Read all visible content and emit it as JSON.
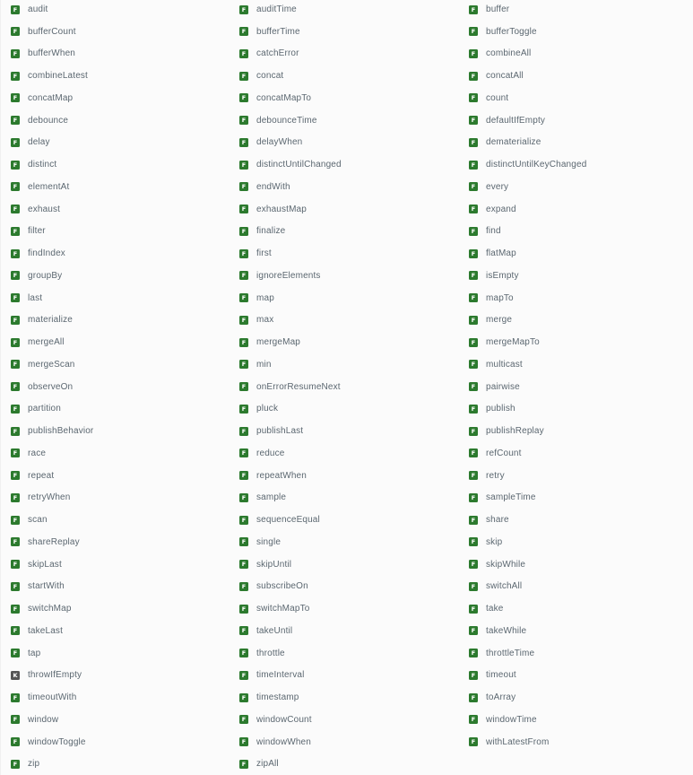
{
  "columns": [
    [
      {
        "badge": "F",
        "name": "audit"
      },
      {
        "badge": "F",
        "name": "bufferCount"
      },
      {
        "badge": "F",
        "name": "bufferWhen"
      },
      {
        "badge": "F",
        "name": "combineLatest"
      },
      {
        "badge": "F",
        "name": "concatMap"
      },
      {
        "badge": "F",
        "name": "debounce"
      },
      {
        "badge": "F",
        "name": "delay"
      },
      {
        "badge": "F",
        "name": "distinct"
      },
      {
        "badge": "F",
        "name": "elementAt"
      },
      {
        "badge": "F",
        "name": "exhaust"
      },
      {
        "badge": "F",
        "name": "filter"
      },
      {
        "badge": "F",
        "name": "findIndex"
      },
      {
        "badge": "F",
        "name": "groupBy"
      },
      {
        "badge": "F",
        "name": "last"
      },
      {
        "badge": "F",
        "name": "materialize"
      },
      {
        "badge": "F",
        "name": "mergeAll"
      },
      {
        "badge": "F",
        "name": "mergeScan"
      },
      {
        "badge": "F",
        "name": "observeOn"
      },
      {
        "badge": "F",
        "name": "partition"
      },
      {
        "badge": "F",
        "name": "publishBehavior"
      },
      {
        "badge": "F",
        "name": "race"
      },
      {
        "badge": "F",
        "name": "repeat"
      },
      {
        "badge": "F",
        "name": "retryWhen"
      },
      {
        "badge": "F",
        "name": "scan"
      },
      {
        "badge": "F",
        "name": "shareReplay"
      },
      {
        "badge": "F",
        "name": "skipLast"
      },
      {
        "badge": "F",
        "name": "startWith"
      },
      {
        "badge": "F",
        "name": "switchMap"
      },
      {
        "badge": "F",
        "name": "takeLast"
      },
      {
        "badge": "F",
        "name": "tap"
      },
      {
        "badge": "K",
        "name": "throwIfEmpty"
      },
      {
        "badge": "F",
        "name": "timeoutWith"
      },
      {
        "badge": "F",
        "name": "window"
      },
      {
        "badge": "F",
        "name": "windowToggle"
      },
      {
        "badge": "F",
        "name": "zip"
      }
    ],
    [
      {
        "badge": "F",
        "name": "auditTime"
      },
      {
        "badge": "F",
        "name": "bufferTime"
      },
      {
        "badge": "F",
        "name": "catchError"
      },
      {
        "badge": "F",
        "name": "concat"
      },
      {
        "badge": "F",
        "name": "concatMapTo"
      },
      {
        "badge": "F",
        "name": "debounceTime"
      },
      {
        "badge": "F",
        "name": "delayWhen"
      },
      {
        "badge": "F",
        "name": "distinctUntilChanged"
      },
      {
        "badge": "F",
        "name": "endWith"
      },
      {
        "badge": "F",
        "name": "exhaustMap"
      },
      {
        "badge": "F",
        "name": "finalize"
      },
      {
        "badge": "F",
        "name": "first"
      },
      {
        "badge": "F",
        "name": "ignoreElements"
      },
      {
        "badge": "F",
        "name": "map"
      },
      {
        "badge": "F",
        "name": "max"
      },
      {
        "badge": "F",
        "name": "mergeMap"
      },
      {
        "badge": "F",
        "name": "min"
      },
      {
        "badge": "F",
        "name": "onErrorResumeNext"
      },
      {
        "badge": "F",
        "name": "pluck"
      },
      {
        "badge": "F",
        "name": "publishLast"
      },
      {
        "badge": "F",
        "name": "reduce"
      },
      {
        "badge": "F",
        "name": "repeatWhen"
      },
      {
        "badge": "F",
        "name": "sample"
      },
      {
        "badge": "F",
        "name": "sequenceEqual"
      },
      {
        "badge": "F",
        "name": "single"
      },
      {
        "badge": "F",
        "name": "skipUntil"
      },
      {
        "badge": "F",
        "name": "subscribeOn"
      },
      {
        "badge": "F",
        "name": "switchMapTo"
      },
      {
        "badge": "F",
        "name": "takeUntil"
      },
      {
        "badge": "F",
        "name": "throttle"
      },
      {
        "badge": "F",
        "name": "timeInterval"
      },
      {
        "badge": "F",
        "name": "timestamp"
      },
      {
        "badge": "F",
        "name": "windowCount"
      },
      {
        "badge": "F",
        "name": "windowWhen"
      },
      {
        "badge": "F",
        "name": "zipAll"
      }
    ],
    [
      {
        "badge": "F",
        "name": "buffer"
      },
      {
        "badge": "F",
        "name": "bufferToggle"
      },
      {
        "badge": "F",
        "name": "combineAll"
      },
      {
        "badge": "F",
        "name": "concatAll"
      },
      {
        "badge": "F",
        "name": "count"
      },
      {
        "badge": "F",
        "name": "defaultIfEmpty"
      },
      {
        "badge": "F",
        "name": "dematerialize"
      },
      {
        "badge": "F",
        "name": "distinctUntilKeyChanged"
      },
      {
        "badge": "F",
        "name": "every"
      },
      {
        "badge": "F",
        "name": "expand"
      },
      {
        "badge": "F",
        "name": "find"
      },
      {
        "badge": "F",
        "name": "flatMap"
      },
      {
        "badge": "F",
        "name": "isEmpty"
      },
      {
        "badge": "F",
        "name": "mapTo"
      },
      {
        "badge": "F",
        "name": "merge"
      },
      {
        "badge": "F",
        "name": "mergeMapTo"
      },
      {
        "badge": "F",
        "name": "multicast"
      },
      {
        "badge": "F",
        "name": "pairwise"
      },
      {
        "badge": "F",
        "name": "publish"
      },
      {
        "badge": "F",
        "name": "publishReplay"
      },
      {
        "badge": "F",
        "name": "refCount"
      },
      {
        "badge": "F",
        "name": "retry"
      },
      {
        "badge": "F",
        "name": "sampleTime"
      },
      {
        "badge": "F",
        "name": "share"
      },
      {
        "badge": "F",
        "name": "skip"
      },
      {
        "badge": "F",
        "name": "skipWhile"
      },
      {
        "badge": "F",
        "name": "switchAll"
      },
      {
        "badge": "F",
        "name": "take"
      },
      {
        "badge": "F",
        "name": "takeWhile"
      },
      {
        "badge": "F",
        "name": "throttleTime"
      },
      {
        "badge": "F",
        "name": "timeout"
      },
      {
        "badge": "F",
        "name": "toArray"
      },
      {
        "badge": "F",
        "name": "windowTime"
      },
      {
        "badge": "F",
        "name": "withLatestFrom"
      }
    ]
  ],
  "colors": {
    "function_badge": "#2c7a2e",
    "const_badge": "#555555",
    "item_text": "#5b6770"
  }
}
